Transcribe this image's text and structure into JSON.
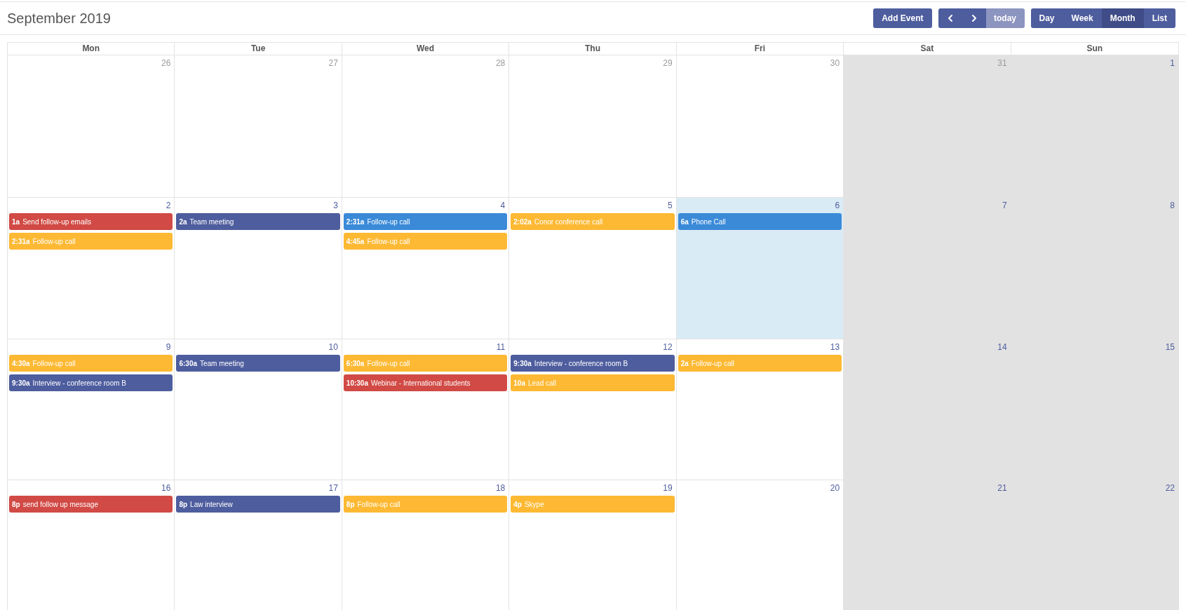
{
  "title": "September 2019",
  "add_button": "Add Event",
  "today_button": {
    "label": "today",
    "disabled": true
  },
  "views": [
    {
      "label": "Day",
      "selected": false
    },
    {
      "label": "Week",
      "selected": false
    },
    {
      "label": "Month",
      "selected": true
    },
    {
      "label": "List",
      "selected": false
    }
  ],
  "columns": [
    {
      "label": "Mon",
      "weekend": false
    },
    {
      "label": "Tue",
      "weekend": false
    },
    {
      "label": "Wed",
      "weekend": false
    },
    {
      "label": "Thu",
      "weekend": false
    },
    {
      "label": "Fri",
      "weekend": false
    },
    {
      "label": "Sat",
      "weekend": true
    },
    {
      "label": "Sun",
      "weekend": true
    }
  ],
  "weeks": [
    {
      "days": [
        {
          "date": "26",
          "other_month": true,
          "today": false
        },
        {
          "date": "27",
          "other_month": true,
          "today": false
        },
        {
          "date": "28",
          "other_month": true,
          "today": false
        },
        {
          "date": "29",
          "other_month": true,
          "today": false
        },
        {
          "date": "30",
          "other_month": true,
          "today": false
        },
        {
          "date": "31",
          "other_month": true,
          "today": false
        },
        {
          "date": "1",
          "other_month": false,
          "today": false
        }
      ]
    },
    {
      "days": [
        {
          "date": "2",
          "other_month": false,
          "today": false,
          "events": [
            {
              "time": "1a",
              "title": "Send follow-up emails",
              "color": "#d14a45"
            },
            {
              "time": "2:31a",
              "title": "Follow-up call",
              "color": "#fdb933"
            }
          ]
        },
        {
          "date": "3",
          "other_month": false,
          "today": false,
          "events": [
            {
              "time": "2a",
              "title": "Team meeting",
              "color": "#4e5d9e"
            }
          ]
        },
        {
          "date": "4",
          "other_month": false,
          "today": false,
          "events": [
            {
              "time": "2:31a",
              "title": "Follow-up call",
              "color": "#3a8ad8"
            },
            {
              "time": "4:45a",
              "title": "Follow-up call",
              "color": "#fdb933"
            }
          ]
        },
        {
          "date": "5",
          "other_month": false,
          "today": false,
          "events": [
            {
              "time": "2:02a",
              "title": "Conor conference call",
              "color": "#fdb933"
            }
          ]
        },
        {
          "date": "6",
          "other_month": false,
          "today": true,
          "events": [
            {
              "time": "6a",
              "title": "Phone Call",
              "color": "#3a8ad8"
            }
          ]
        },
        {
          "date": "7",
          "other_month": false,
          "today": false
        },
        {
          "date": "8",
          "other_month": false,
          "today": false
        }
      ]
    },
    {
      "days": [
        {
          "date": "9",
          "other_month": false,
          "today": false,
          "events": [
            {
              "time": "4:30a",
              "title": "Follow-up call",
              "color": "#fdb933"
            },
            {
              "time": "9:30a",
              "title": "Interview - conference room B",
              "color": "#4e5d9e"
            }
          ]
        },
        {
          "date": "10",
          "other_month": false,
          "today": false,
          "events": [
            {
              "time": "6:30a",
              "title": "Team meeting",
              "color": "#4e5d9e"
            }
          ]
        },
        {
          "date": "11",
          "other_month": false,
          "today": false,
          "events": [
            {
              "time": "6:30a",
              "title": "Follow-up call",
              "color": "#fdb933"
            },
            {
              "time": "10:30a",
              "title": "Webinar - International students",
              "color": "#d14a45"
            }
          ]
        },
        {
          "date": "12",
          "other_month": false,
          "today": false,
          "events": [
            {
              "time": "9:30a",
              "title": "Interview - conference room B",
              "color": "#4e5d9e"
            },
            {
              "time": "10a",
              "title": "Lead call",
              "color": "#fdb933"
            }
          ]
        },
        {
          "date": "13",
          "other_month": false,
          "today": false,
          "events": [
            {
              "time": "2a",
              "title": "Follow-up call",
              "color": "#fdb933"
            }
          ]
        },
        {
          "date": "14",
          "other_month": false,
          "today": false
        },
        {
          "date": "15",
          "other_month": false,
          "today": false
        }
      ]
    },
    {
      "days": [
        {
          "date": "16",
          "other_month": false,
          "today": false,
          "events": [
            {
              "time": "8p",
              "title": "send follow up message",
              "color": "#d14a45"
            }
          ]
        },
        {
          "date": "17",
          "other_month": false,
          "today": false,
          "events": [
            {
              "time": "8p",
              "title": "Law interview",
              "color": "#4e5d9e"
            }
          ]
        },
        {
          "date": "18",
          "other_month": false,
          "today": false,
          "events": [
            {
              "time": "8p",
              "title": "Follow-up call",
              "color": "#fdb933"
            }
          ]
        },
        {
          "date": "19",
          "other_month": false,
          "today": false,
          "events": [
            {
              "time": "4p",
              "title": "Skype",
              "color": "#fdb933"
            }
          ]
        },
        {
          "date": "20",
          "other_month": false,
          "today": false
        },
        {
          "date": "21",
          "other_month": false,
          "today": false
        },
        {
          "date": "22",
          "other_month": false,
          "today": false
        }
      ]
    }
  ]
}
